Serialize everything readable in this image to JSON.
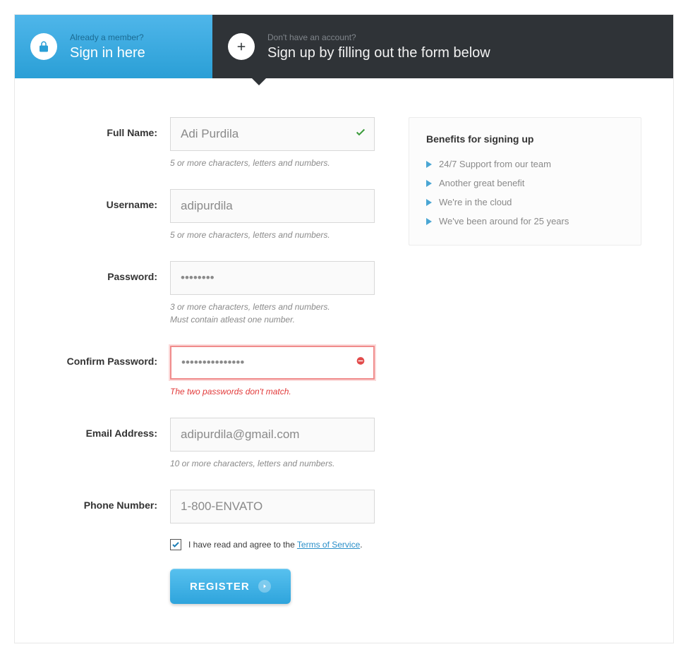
{
  "tabs": {
    "signin": {
      "small": "Already a member?",
      "large": "Sign in here"
    },
    "signup": {
      "small": "Don't have an account?",
      "large": "Sign up by filling out the form below"
    }
  },
  "form": {
    "fullname": {
      "label": "Full Name:",
      "value": "Adi Purdila",
      "hint": "5 or more characters, letters and numbers."
    },
    "username": {
      "label": "Username:",
      "value": "adipurdila",
      "hint": "5 or more characters, letters and numbers."
    },
    "password": {
      "label": "Password:",
      "value_mask": "********",
      "hint": "3 or more characters, letters and numbers.\nMust contain atleast one number."
    },
    "confirm": {
      "label": "Confirm Password:",
      "value_mask": "***************",
      "error": "The two passwords don't match."
    },
    "email": {
      "label": "Email Address:",
      "value": "adipurdila@gmail.com",
      "hint": "10 or more characters, letters and numbers."
    },
    "phone": {
      "label": "Phone Number:",
      "value": "1-800-ENVATO"
    },
    "tos_prefix": "I have read and agree to the ",
    "tos_link": "Terms of Service",
    "tos_suffix": ".",
    "submit": "REGISTER"
  },
  "benefits": {
    "title": "Benefits for signing up",
    "items": [
      "24/7 Support from our team",
      "Another great benefit",
      "We're in the cloud",
      "We've been around for 25 years"
    ]
  }
}
